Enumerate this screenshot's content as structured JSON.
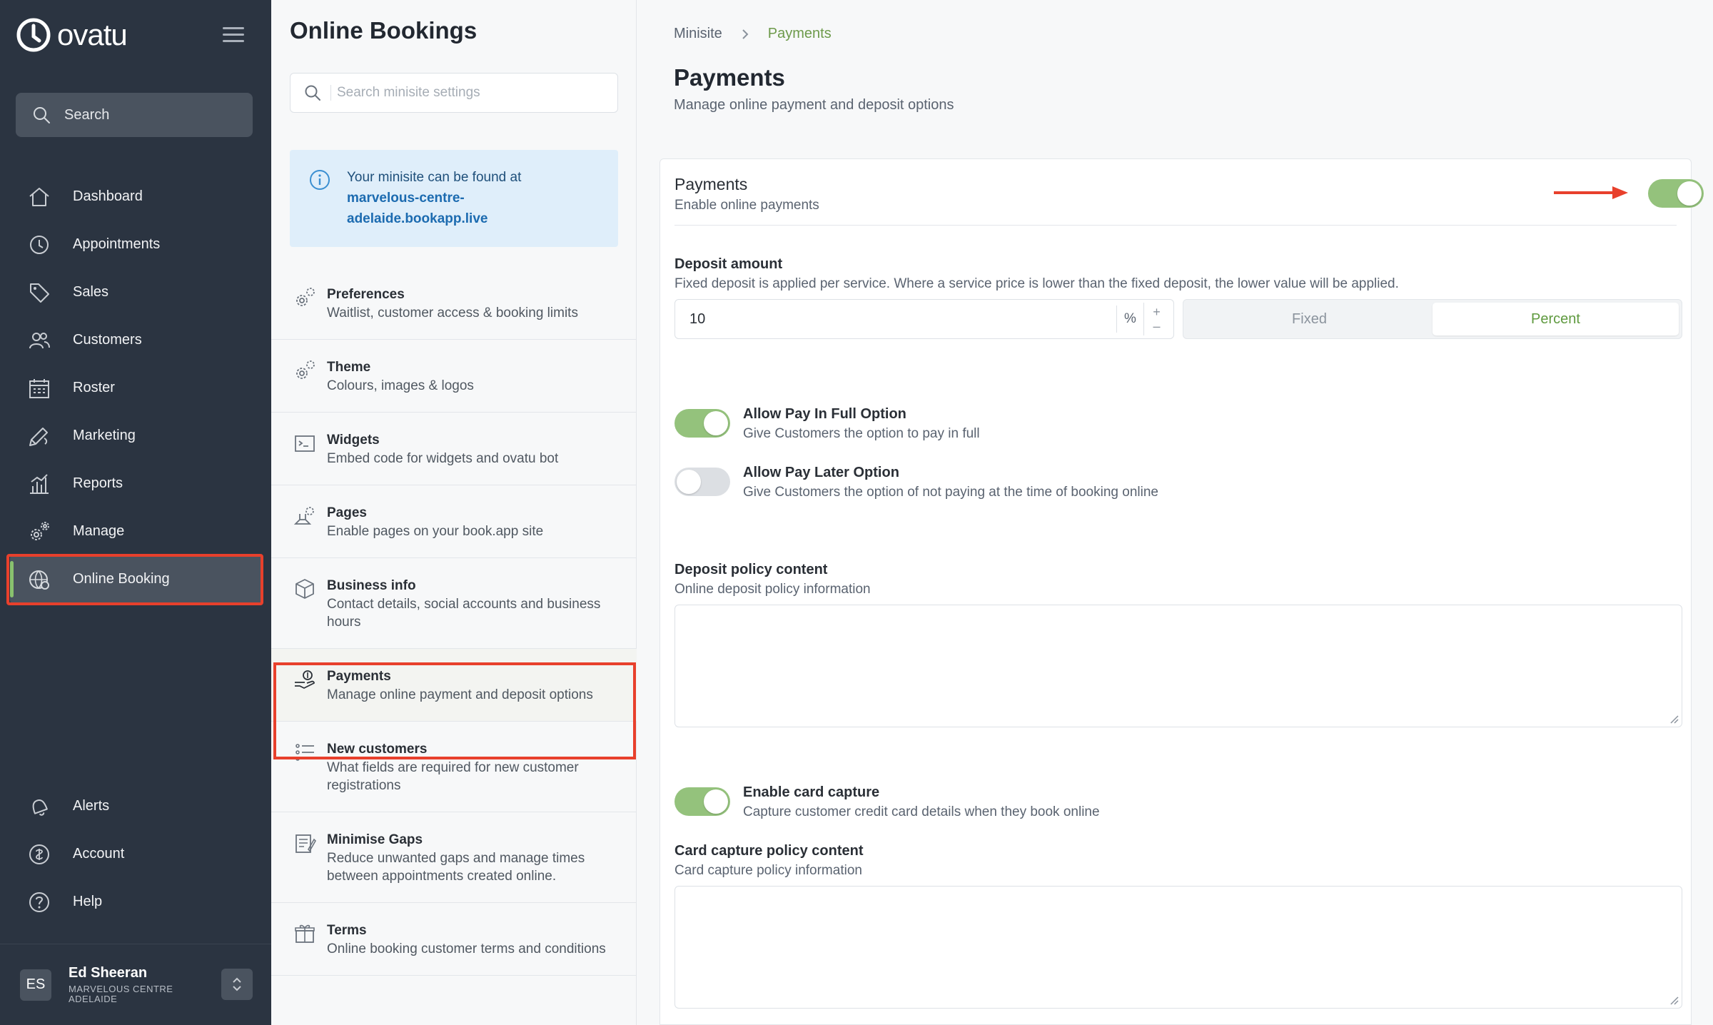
{
  "app": {
    "brand": "ovatu",
    "search_label": "Search"
  },
  "sidebar": {
    "items": [
      {
        "label": "Dashboard",
        "icon": "home-icon"
      },
      {
        "label": "Appointments",
        "icon": "clock-icon"
      },
      {
        "label": "Sales",
        "icon": "tag-icon"
      },
      {
        "label": "Customers",
        "icon": "users-icon"
      },
      {
        "label": "Roster",
        "icon": "calendar-icon"
      },
      {
        "label": "Marketing",
        "icon": "megaphone-icon"
      },
      {
        "label": "Reports",
        "icon": "bar-chart-icon"
      },
      {
        "label": "Manage",
        "icon": "gears-icon"
      },
      {
        "label": "Online Booking",
        "icon": "globe-gear-icon",
        "active": true
      }
    ],
    "bottom_items": [
      {
        "label": "Alerts",
        "icon": "bell-icon"
      },
      {
        "label": "Account",
        "icon": "account-icon"
      },
      {
        "label": "Help",
        "icon": "help-icon"
      }
    ],
    "user": {
      "initials": "ES",
      "name": "Ed Sheeran",
      "org": "MARVELOUS CENTRE ADELAIDE"
    }
  },
  "settings_panel": {
    "title": "Online Bookings",
    "search_placeholder": "Search minisite settings",
    "info_text": "Your minisite can be found at",
    "info_link": "marvelous-centre-adelaide.bookapp.live",
    "items": [
      {
        "title": "Preferences",
        "desc": "Waitlist, customer access & booking limits",
        "icon": "gears-icon"
      },
      {
        "title": "Theme",
        "desc": "Colours, images & logos",
        "icon": "gears-icon"
      },
      {
        "title": "Widgets",
        "desc": "Embed code for widgets and ovatu bot",
        "icon": "terminal-icon"
      },
      {
        "title": "Pages",
        "desc": "Enable pages on your book.app site",
        "icon": "pages-icon"
      },
      {
        "title": "Business info",
        "desc": "Contact details, social accounts and business hours",
        "icon": "box-icon"
      },
      {
        "title": "Payments",
        "desc": "Manage online payment and deposit options",
        "icon": "payment-hand-icon",
        "active": true
      },
      {
        "title": "New customers",
        "desc": "What fields are required for new customer registrations",
        "icon": "list-icon"
      },
      {
        "title": "Minimise Gaps",
        "desc": "Reduce unwanted gaps and manage times between appointments created online.",
        "icon": "notepad-icon"
      },
      {
        "title": "Terms",
        "desc": "Online booking customer terms and conditions",
        "icon": "gift-icon"
      }
    ]
  },
  "main": {
    "breadcrumb": [
      "Minisite",
      "Payments"
    ],
    "title": "Payments",
    "subtitle": "Manage online payment and deposit options",
    "payments": {
      "title": "Payments",
      "desc": "Enable online payments",
      "enabled": true
    },
    "deposit": {
      "label": "Deposit amount",
      "desc": "Fixed deposit is applied per service. Where a service price is lower than the fixed deposit, the lower value will be applied.",
      "value": "10",
      "unit": "%",
      "step_up": "+",
      "step_down": "–",
      "options": [
        "Fixed",
        "Percent"
      ],
      "selected": "Percent"
    },
    "pay_in_full": {
      "label": "Allow Pay In Full Option",
      "desc": "Give Customers the option to pay in full",
      "enabled": true
    },
    "pay_later": {
      "label": "Allow Pay Later Option",
      "desc": "Give Customers the option of not paying at the time of booking online",
      "enabled": false
    },
    "deposit_policy": {
      "label": "Deposit policy content",
      "desc": "Online deposit policy information",
      "value": ""
    },
    "card_capture": {
      "label": "Enable card capture",
      "desc": "Capture customer credit card details when they book online",
      "enabled": true
    },
    "card_policy": {
      "label": "Card capture policy content",
      "desc": "Card capture policy information",
      "value": ""
    }
  },
  "colors": {
    "sidebar_bg": "#2b3441",
    "accent_green": "#94c27c",
    "highlight_red": "#e8402c",
    "info_bg": "#dfeefa"
  }
}
